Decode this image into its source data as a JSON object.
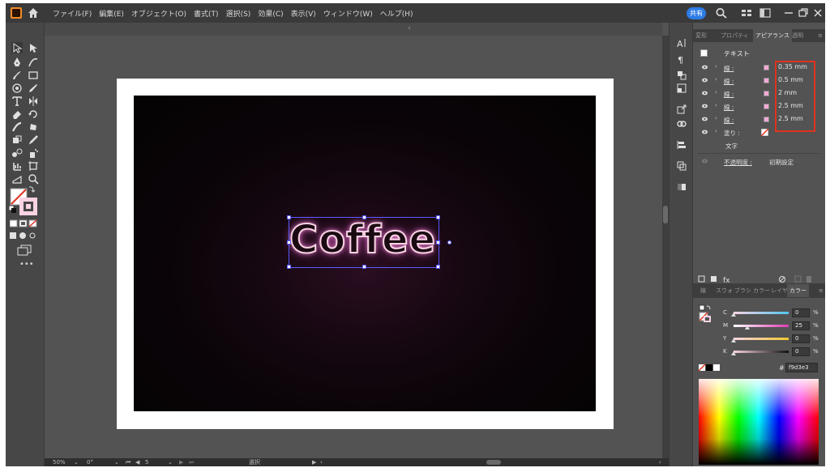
{
  "menubar": {
    "items": [
      "ファイル(F)",
      "編集(E)",
      "オブジェクト(O)",
      "書式(T)",
      "選択(S)",
      "効果(C)",
      "表示(V)",
      "ウィンドウ(W)",
      "ヘルプ(H)"
    ],
    "share_label": "共有"
  },
  "canvas": {
    "artwork_text": "Coffee"
  },
  "status": {
    "zoom": "50%",
    "rotate": "0°",
    "artboard": "5",
    "tool": "選択"
  },
  "appearance": {
    "tabs": [
      "変形",
      "プロパティ",
      "アピアランス",
      "透明"
    ],
    "active_tab": "アピアランス",
    "header": "テキスト",
    "strokes": [
      {
        "label": "線 :",
        "value": "0.35 mm"
      },
      {
        "label": "線 :",
        "value": "0.5 mm"
      },
      {
        "label": "線 :",
        "value": "2 mm"
      },
      {
        "label": "線 :",
        "value": "2.5 mm"
      },
      {
        "label": "線 :",
        "value": "2.5 mm"
      }
    ],
    "fill_label": "塗り :",
    "character_label": "文字",
    "opacity_label": "不透明度 :",
    "opacity_value": "初期設定"
  },
  "colorpanel": {
    "tabs": [
      "線",
      "スウォ",
      "ブラシ",
      "カラー",
      "レイヤ",
      "カラー"
    ],
    "sliders": [
      {
        "label": "C",
        "value": "0",
        "unit": "%",
        "fraction": 0.0
      },
      {
        "label": "M",
        "value": "25",
        "unit": "%",
        "fraction": 0.25
      },
      {
        "label": "Y",
        "value": "0",
        "unit": "%",
        "fraction": 0.0
      },
      {
        "label": "K",
        "value": "0",
        "unit": "%",
        "fraction": 0.0
      }
    ],
    "hex_prefix": "#",
    "hex_value": "f9d3e3"
  },
  "colors": {
    "accent": "#2d7be5",
    "stroke_swatch": "#f3a8d6",
    "highlight": "#e0321e",
    "fill_color": "#f9d3e3"
  }
}
